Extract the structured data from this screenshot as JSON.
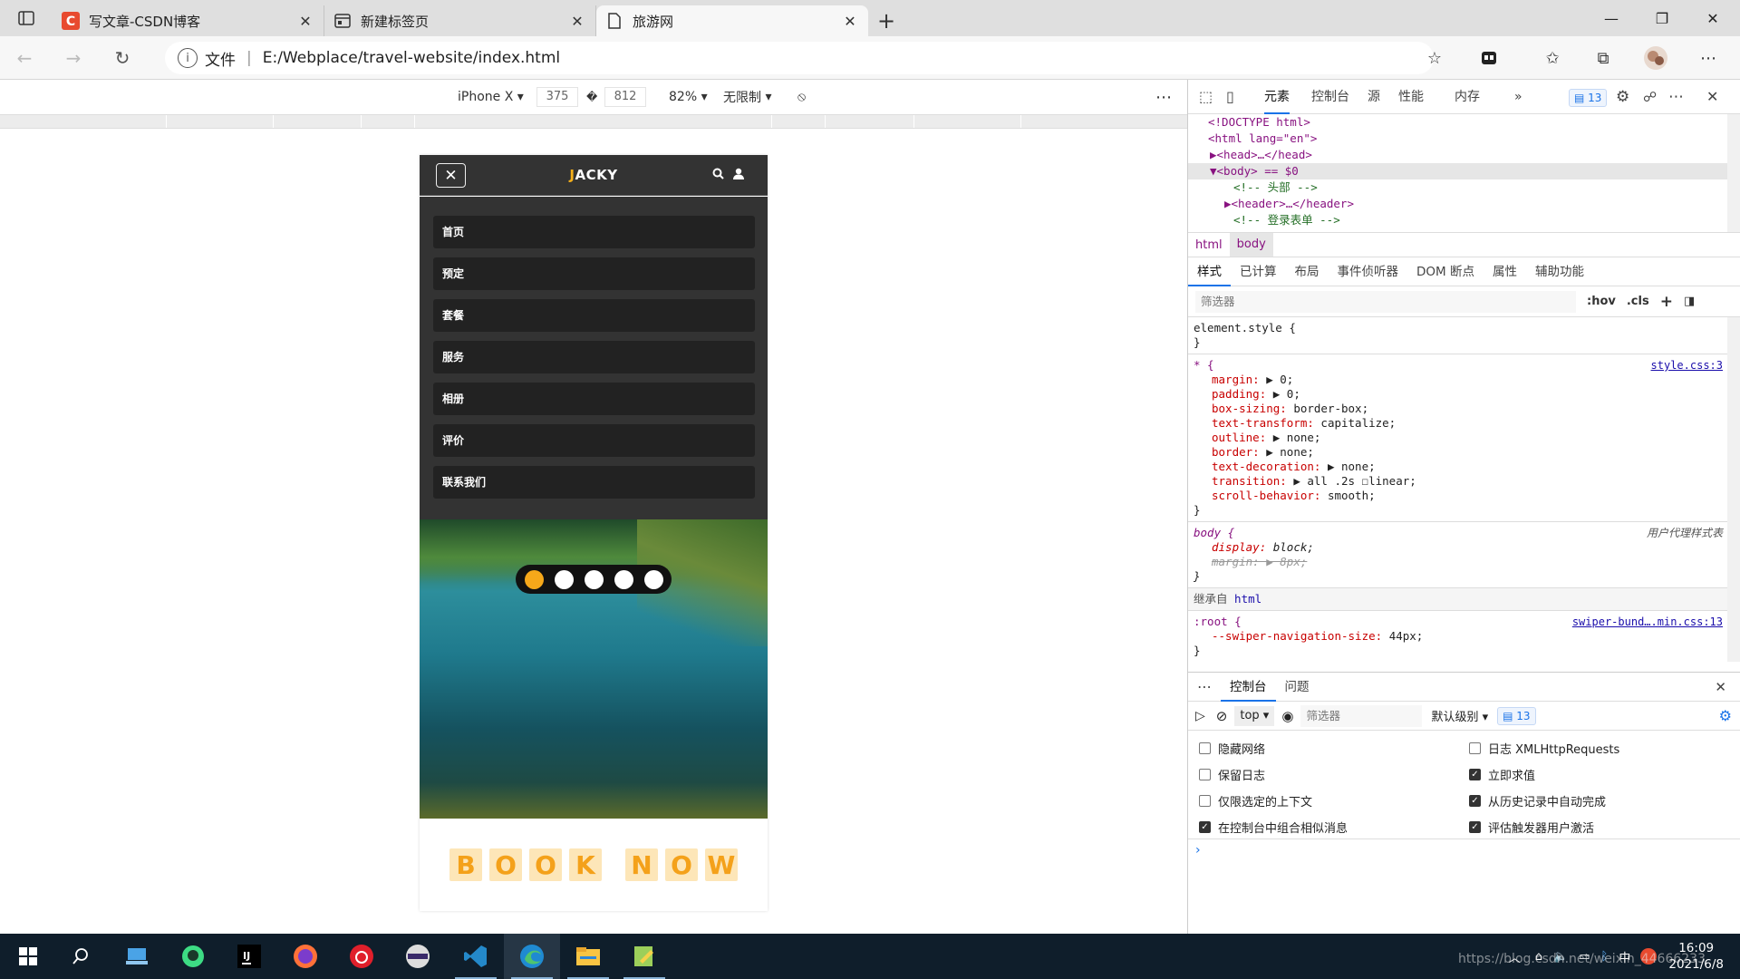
{
  "browser": {
    "tabs": [
      {
        "title": "写文章-CSDN博客",
        "favicon": "csdn-icon",
        "active": false
      },
      {
        "title": "新建标签页",
        "favicon": "newtab-icon",
        "active": false
      },
      {
        "title": "旅游网",
        "favicon": "document-icon",
        "active": true
      }
    ],
    "address": {
      "scheme_label": "文件",
      "url": "E:/Webplace/travel-website/index.html"
    }
  },
  "emulation": {
    "device": "iPhone X",
    "width": "375",
    "height": "812",
    "separator_glyph": "�",
    "zoom": "82%",
    "throttle": "无限制"
  },
  "site": {
    "logo_first": "J",
    "logo_rest": "ACKY",
    "close_glyph": "✕",
    "menu": [
      "首页",
      "预定",
      "套餐",
      "服务",
      "相册",
      "评价",
      "联系我们"
    ],
    "slider_active_index": 0,
    "slider_count": 5,
    "book_letters_1": [
      "B",
      "O",
      "O",
      "K"
    ],
    "book_letters_2": [
      "N",
      "O",
      "W"
    ],
    "accent": "#f6a81a"
  },
  "devtools": {
    "tabs": [
      "元素",
      "控制台",
      "源",
      "性能",
      "内存"
    ],
    "more_tabs": "»",
    "issue_count": "13",
    "dom_lines": [
      {
        "text": "<!DOCTYPE html>",
        "indent": 1
      },
      {
        "text": "<html lang=\"en\">",
        "indent": 1
      },
      {
        "text": "▶<head>…</head>",
        "indent": 1
      },
      {
        "text": "▼<body> == $0",
        "indent": 1,
        "selected": true
      },
      {
        "text": "<!-- 头部 -->",
        "indent": 2,
        "comment": true
      },
      {
        "text": "▶<header>…</header>",
        "indent": 2
      },
      {
        "text": "<!-- 登录表单 -->",
        "indent": 2,
        "comment": true
      }
    ],
    "breadcrumbs": [
      "html",
      "body"
    ],
    "subtabs": [
      "样式",
      "已计算",
      "布局",
      "事件侦听器",
      "DOM 断点",
      "属性",
      "辅助功能"
    ],
    "filter_placeholder": "筛选器",
    "hov": ":hov",
    "cls": ".cls",
    "plus": "+",
    "rules": {
      "element_style": "element.style {",
      "close": "}",
      "universal_selector": "* {",
      "universal_source": "style.css:3",
      "universal_props": [
        {
          "name": "margin",
          "value": "▶ 0;"
        },
        {
          "name": "padding",
          "value": "▶ 0;"
        },
        {
          "name": "box-sizing",
          "value": "border-box;"
        },
        {
          "name": "text-transform",
          "value": "capitalize;"
        },
        {
          "name": "outline",
          "value": "▶ none;"
        },
        {
          "name": "border",
          "value": "▶ none;"
        },
        {
          "name": "text-decoration",
          "value": "▶ none;"
        },
        {
          "name": "transition",
          "value": "▶ all .2s ☐linear;"
        },
        {
          "name": "scroll-behavior",
          "value": "smooth;"
        }
      ],
      "body_selector": "body {",
      "body_source": "用户代理样式表",
      "body_display_name": "display",
      "body_display_value": "block;",
      "body_margin_name": "margin",
      "body_margin_value": "▶ 8px;",
      "inherited_label": "继承自",
      "inherited_from": "html",
      "root_selector": ":root {",
      "root_source": "swiper-bund….min.css:13",
      "root_prop_name": "--swiper-navigation-size",
      "root_prop_value": "44px;"
    },
    "drawer": {
      "tabs": [
        "控制台",
        "问题"
      ],
      "context": "top",
      "filter_placeholder": "筛选器",
      "level": "默认级别",
      "count": "13",
      "settings": [
        {
          "label": "隐藏网络",
          "checked": false
        },
        {
          "label": "日志 XMLHttpRequests",
          "checked": false
        },
        {
          "label": "保留日志",
          "checked": false
        },
        {
          "label": "立即求值",
          "checked": true
        },
        {
          "label": "仅限选定的上下文",
          "checked": false
        },
        {
          "label": "从历史记录中自动完成",
          "checked": true
        },
        {
          "label": "在控制台中组合相似消息",
          "checked": true
        },
        {
          "label": "评估触发器用户激活",
          "checked": true
        }
      ],
      "prompt": "›"
    }
  },
  "taskbar": {
    "time": "16:09",
    "date": "2021/6/8",
    "watermark": "https://blog.csdn.net/weixin_44666233",
    "ime": "中"
  }
}
